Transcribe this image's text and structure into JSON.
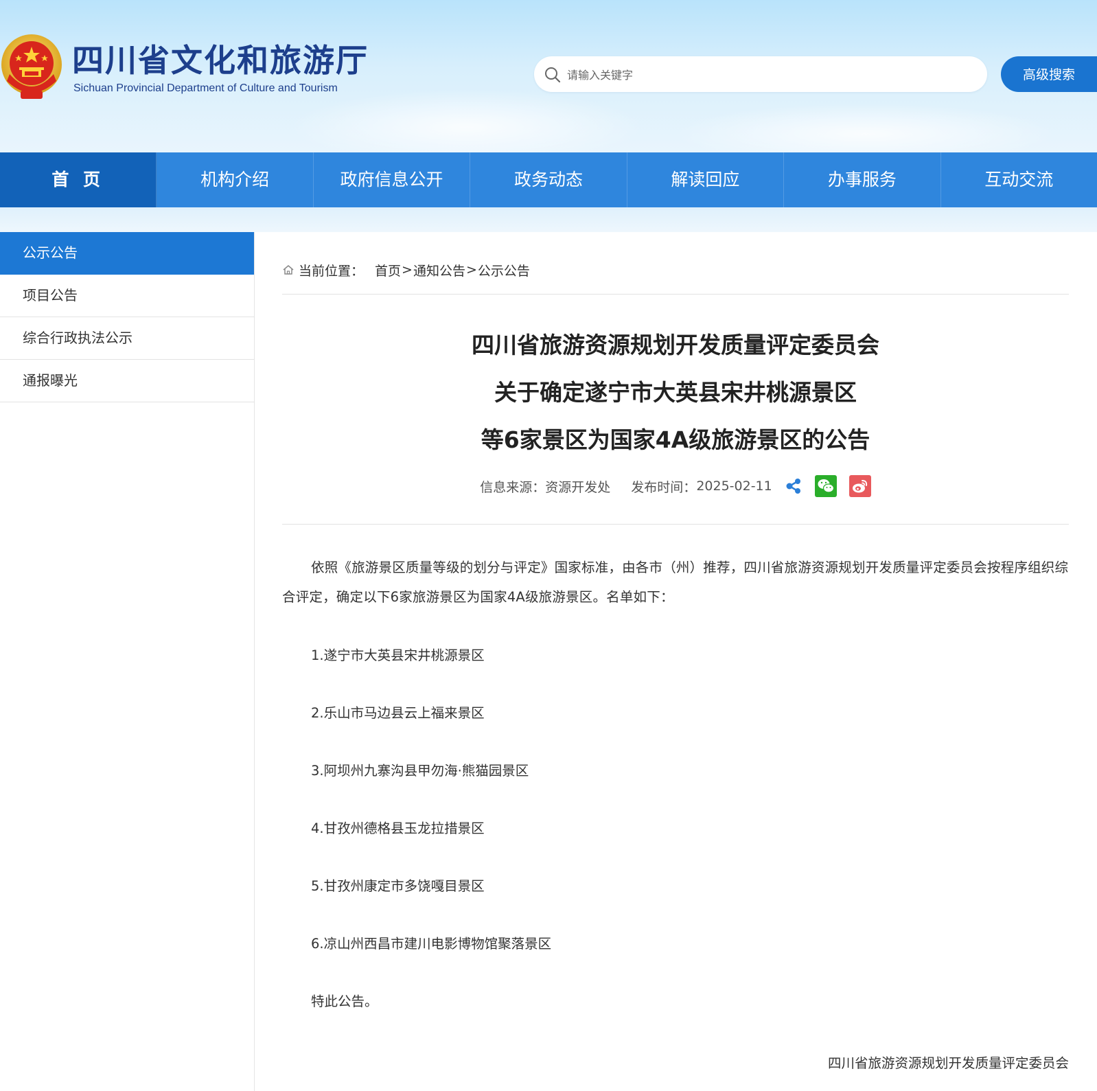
{
  "header": {
    "title": "四川省文化和旅游厅",
    "subtitle": "Sichuan Provincial Department of Culture and Tourism",
    "search_placeholder": "请输入关键字",
    "advanced_search_label": "高级搜索"
  },
  "nav": {
    "items": [
      {
        "label": "首 页",
        "active": true
      },
      {
        "label": "机构介绍"
      },
      {
        "label": "政府信息公开"
      },
      {
        "label": "政务动态"
      },
      {
        "label": "解读回应"
      },
      {
        "label": "办事服务"
      },
      {
        "label": "互动交流"
      }
    ]
  },
  "sidebar": {
    "items": [
      {
        "label": "公示公告",
        "active": true
      },
      {
        "label": "项目公告"
      },
      {
        "label": "综合行政执法公示"
      },
      {
        "label": "通报曝光"
      }
    ]
  },
  "breadcrumb": {
    "label": "当前位置：",
    "items": [
      "首页",
      "通知公告",
      "公示公告"
    ],
    "separator": ">"
  },
  "article": {
    "title_lines": [
      "四川省旅游资源规划开发质量评定委员会",
      "关于确定遂宁市大英县宋井桃源景区",
      "等6家景区为国家4A级旅游景区的公告"
    ],
    "source_label": "信息来源：",
    "source": "资源开发处",
    "date_label": "发布时间：",
    "date": "2025-02-11",
    "intro": "依照《旅游景区质量等级的划分与评定》国家标准，由各市（州）推荐，四川省旅游资源规划开发质量评定委员会按程序组织综合评定，确定以下6家旅游景区为国家4A级旅游景区。名单如下：",
    "list": [
      "1.遂宁市大英县宋井桃源景区",
      "2.乐山市马边县云上福来景区",
      "3.阿坝州九寨沟县甲勿海·熊猫园景区",
      "4.甘孜州德格县玉龙拉措景区",
      "5.甘孜州康定市多饶嘎目景区",
      "6.凉山州西昌市建川电影博物馆聚落景区"
    ],
    "closing": "特此公告。",
    "signature": "四川省旅游资源规划开发质量评定委员会"
  },
  "colors": {
    "nav_bg": "#2f86dd",
    "nav_active": "#1262b8",
    "sidebar_active": "#1d78d4",
    "title_blue": "#1d3f8c",
    "wechat_green": "#2aae2a",
    "weibo_red": "#e8595c"
  },
  "icons": {
    "emblem": "national-emblem-icon",
    "search": "search-icon",
    "home": "home-icon",
    "share": "share-icon",
    "wechat": "wechat-icon",
    "weibo": "weibo-icon"
  }
}
